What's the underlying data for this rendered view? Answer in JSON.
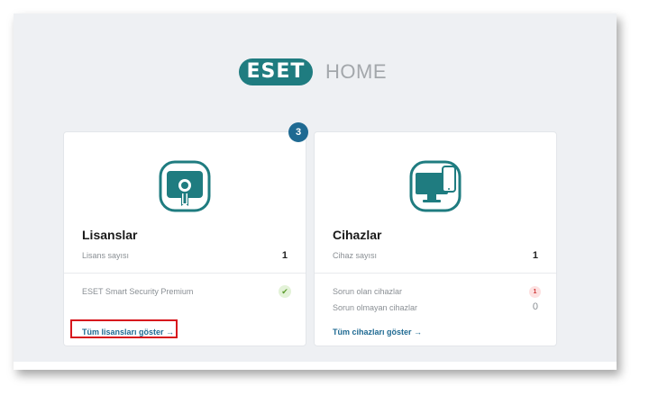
{
  "header": {
    "logo_text": "ESET",
    "product": "HOME"
  },
  "licenses": {
    "badge_count": "3",
    "title": "Lisanslar",
    "count_label": "Lisans sayısı",
    "count_value": "1",
    "product_name": "ESET Smart Security Premium",
    "status_icon": "check-icon",
    "link": "Tüm lisansları göster →"
  },
  "devices": {
    "title": "Cihazlar",
    "count_label": "Cihaz sayısı",
    "count_value": "1",
    "problem_label": "Sorun olan cihazlar",
    "problem_value": "1",
    "ok_label": "Sorun olmayan cihazlar",
    "ok_value": "0",
    "link": "Tüm cihazları göster →"
  },
  "colors": {
    "brand_teal": "#1f7c80",
    "link_blue": "#1f6a92",
    "highlight_red": "#d7161d"
  }
}
